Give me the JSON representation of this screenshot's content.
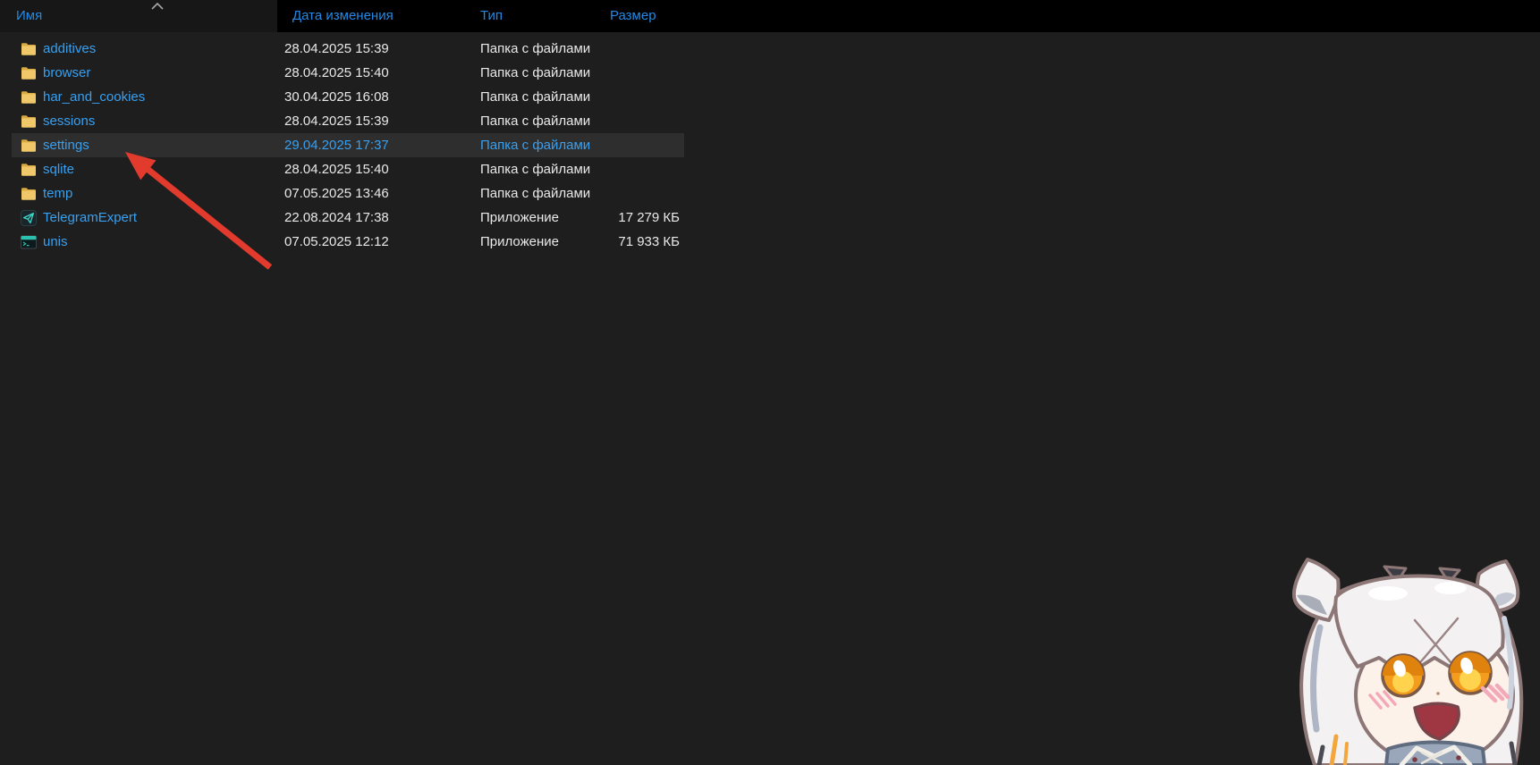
{
  "columns": {
    "name": "Имя",
    "modified": "Дата изменения",
    "type": "Тип",
    "size": "Размер"
  },
  "sort": {
    "column": "Имя",
    "direction": "ascending",
    "indicator": "chevron-up-icon"
  },
  "rows": [
    {
      "name": "additives",
      "modified": "28.04.2025 15:39",
      "type": "Папка с файлами",
      "size": "",
      "icon": "folder-icon",
      "highlighted": false
    },
    {
      "name": "browser",
      "modified": "28.04.2025 15:40",
      "type": "Папка с файлами",
      "size": "",
      "icon": "folder-icon",
      "highlighted": false
    },
    {
      "name": "har_and_cookies",
      "modified": "30.04.2025 16:08",
      "type": "Папка с файлами",
      "size": "",
      "icon": "folder-icon",
      "highlighted": false
    },
    {
      "name": "sessions",
      "modified": "28.04.2025 15:39",
      "type": "Папка с файлами",
      "size": "",
      "icon": "folder-icon",
      "highlighted": false
    },
    {
      "name": "settings",
      "modified": "29.04.2025 17:37",
      "type": "Папка с файлами",
      "size": "",
      "icon": "folder-icon",
      "highlighted": true
    },
    {
      "name": "sqlite",
      "modified": "28.04.2025 15:40",
      "type": "Папка с файлами",
      "size": "",
      "icon": "folder-icon",
      "highlighted": false
    },
    {
      "name": "temp",
      "modified": "07.05.2025 13:46",
      "type": "Папка с файлами",
      "size": "",
      "icon": "folder-icon",
      "highlighted": false
    },
    {
      "name": "TelegramExpert",
      "modified": "22.08.2024 17:38",
      "type": "Приложение",
      "size": "17 279 КБ",
      "icon": "telegram-app-icon",
      "highlighted": false
    },
    {
      "name": "unis",
      "modified": "07.05.2025 12:12",
      "type": "Приложение",
      "size": "71 933 КБ",
      "icon": "console-app-icon",
      "highlighted": false
    }
  ],
  "annotation": {
    "shape": "red-arrow",
    "target_row": "settings"
  },
  "sticker": {
    "description": "anime-catgirl-sticker"
  },
  "colors": {
    "header_accent": "#2389e5",
    "filename_blue": "#38a0f0",
    "row_highlight": "#2e2e2e",
    "header_bg": "#000000",
    "content_bg": "#1e1e1e",
    "arrow_red": "#e23b2e",
    "folder_yellow": "#f0c869",
    "app_teal": "#3fd6c6"
  }
}
